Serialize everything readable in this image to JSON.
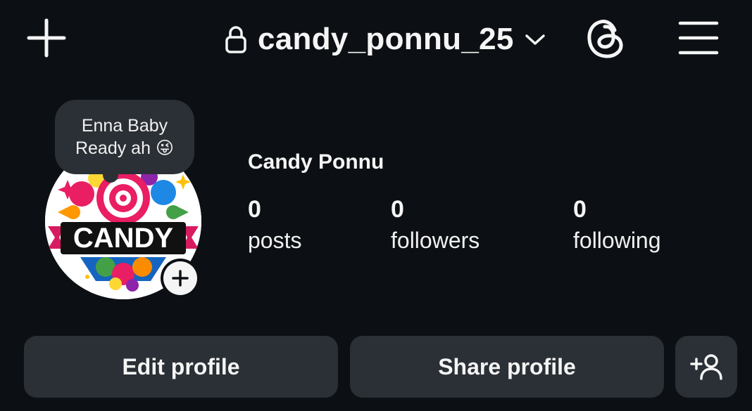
{
  "header": {
    "username": "candy_ponnu_25",
    "new_post_icon": "plus-icon",
    "lock_icon": "lock-icon",
    "dropdown_icon": "chevron-down-icon",
    "threads_icon": "threads-icon",
    "menu_icon": "hamburger-menu-icon"
  },
  "note": {
    "line1": "Enna Baby",
    "line2": "Ready ah",
    "emoji": "😜"
  },
  "profile": {
    "display_name": "Candy Ponnu",
    "avatar_text": "CANDY",
    "stats": [
      {
        "value": "0",
        "label": "posts"
      },
      {
        "value": "0",
        "label": "followers"
      },
      {
        "value": "0",
        "label": "following"
      }
    ]
  },
  "actions": {
    "edit_label": "Edit profile",
    "share_label": "Share profile",
    "discover_icon": "add-person-icon"
  },
  "colors": {
    "background": "#0c1014",
    "surface": "#2b3036",
    "text": "#f5f5f5"
  }
}
